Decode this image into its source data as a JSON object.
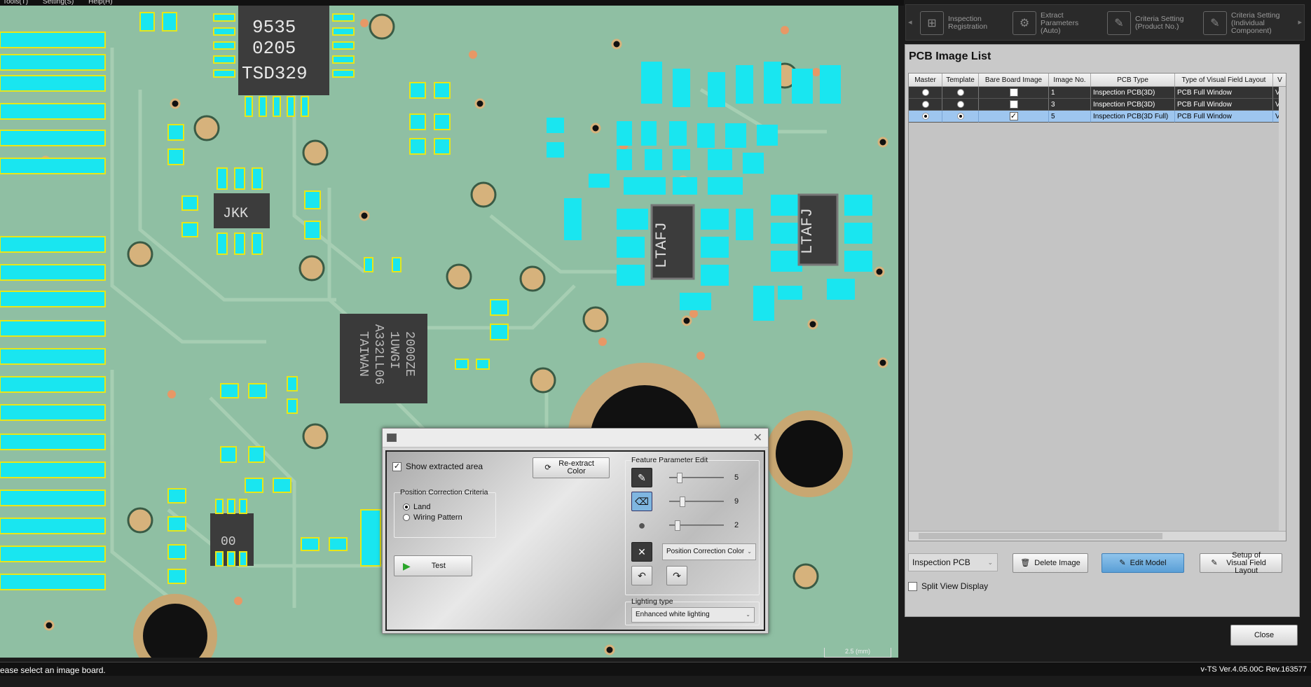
{
  "menu": {
    "items": [
      "Tools(T)",
      "Setting(S)",
      "Help(H)"
    ]
  },
  "toolbar": {
    "prev_arrow": "◂",
    "next_arrow": "▸",
    "items": [
      {
        "label": "Inspection Registration",
        "icon": "grid-target-icon"
      },
      {
        "label": "Extract Parameters (Auto)",
        "icon": "gear-icon"
      },
      {
        "label": "Criteria Setting (Product No.)",
        "icon": "pencil-icon"
      },
      {
        "label": "Criteria Setting (Individual Component)",
        "icon": "pencil-grid-icon"
      }
    ]
  },
  "panel": {
    "title": "PCB Image List",
    "columns": [
      "Master",
      "Template",
      "Bare Board Image",
      "Image No.",
      "PCB Type",
      "Type of Visual Field Layout",
      "V"
    ],
    "rows": [
      {
        "master": false,
        "template": false,
        "bare": false,
        "image_no": "1",
        "pcb_type": "Inspection PCB(3D)",
        "layout": "PCB Full Window",
        "v": "V",
        "selected": false
      },
      {
        "master": false,
        "template": false,
        "bare": false,
        "image_no": "3",
        "pcb_type": "Inspection PCB(3D)",
        "layout": "PCB Full Window",
        "v": "V",
        "selected": false
      },
      {
        "master": true,
        "template": true,
        "bare": true,
        "image_no": "5",
        "pcb_type": "Inspection PCB(3D Full)",
        "layout": "PCB Full Window",
        "v": "V",
        "selected": true
      }
    ],
    "pcb_combo": "Inspection PCB",
    "delete_label": "Delete Image",
    "edit_label": "Edit Model",
    "setup_label": "Setup of Visual Field Layout",
    "split_view_label": "Split View Display",
    "split_view_checked": false,
    "close_label": "Close"
  },
  "dialog": {
    "show_extracted_label": "Show extracted area",
    "show_extracted_checked": true,
    "reextract_label": "Re-extract Color",
    "position_group_title": "Position Correction Criteria",
    "radio_land": "Land",
    "radio_wiring": "Wiring Pattern",
    "radio_selected": "Land",
    "test_label": "Test",
    "feature_group_title": "Feature Parameter Edit",
    "slider_values": [
      "5",
      "9",
      "2"
    ],
    "slider_levels": [
      0.15,
      0.22,
      0.12
    ],
    "position_select": "Position Correction Color",
    "lighting_title": "Lighting type",
    "lighting_select": "Enhanced white lighting"
  },
  "viewport": {
    "scale_label": "2.5 (mm)",
    "chip_texts": [
      "9535",
      "0205",
      "TSD329",
      "JKK",
      "2000ZE",
      "1UWGI",
      "A332LL06",
      "TAIWAN",
      "LTAFJ",
      "LTAFJ",
      "00"
    ]
  },
  "status": {
    "message": "ease select an image board.",
    "version": "v-TS Ver.4.05.00C Rev.163577"
  },
  "colors": {
    "pad_highlight": "#19e6f0",
    "board": "#8fbfa3",
    "selected_row": "#9ec6ef",
    "accent_button": "#5a9fd6"
  }
}
